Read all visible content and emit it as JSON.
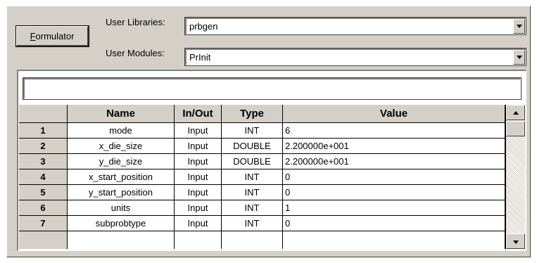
{
  "formulator_button": {
    "label_first": "F",
    "label_rest": "ormulator"
  },
  "user_libraries": {
    "label": "User Libraries:",
    "value": "prbgen"
  },
  "user_modules": {
    "label": "User Modules:",
    "value": "PrInit"
  },
  "edit_bar": {
    "value": ""
  },
  "table": {
    "columns": [
      "",
      "Name",
      "In/Out",
      "Type",
      "Value"
    ],
    "rows": [
      {
        "num": "1",
        "name": "mode",
        "inout": "Input",
        "type": "INT",
        "value": "6"
      },
      {
        "num": "2",
        "name": "x_die_size",
        "inout": "Input",
        "type": "DOUBLE",
        "value": "2.200000e+001"
      },
      {
        "num": "3",
        "name": "y_die_size",
        "inout": "Input",
        "type": "DOUBLE",
        "value": "2.200000e+001"
      },
      {
        "num": "4",
        "name": "x_start_position",
        "inout": "Input",
        "type": "INT",
        "value": "0"
      },
      {
        "num": "5",
        "name": "y_start_position",
        "inout": "Input",
        "type": "INT",
        "value": "0"
      },
      {
        "num": "6",
        "name": "units",
        "inout": "Input",
        "type": "INT",
        "value": "1"
      },
      {
        "num": "7",
        "name": "subprobtype",
        "inout": "Input",
        "type": "INT",
        "value": "0"
      }
    ]
  }
}
